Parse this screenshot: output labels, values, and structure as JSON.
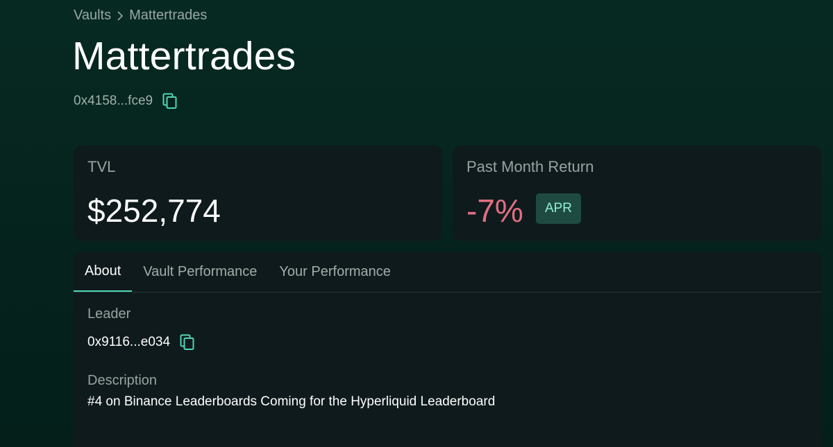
{
  "breadcrumb": {
    "parent": "Vaults",
    "current": "Mattertrades"
  },
  "vault": {
    "name": "Mattertrades",
    "address": "0x4158...fce9"
  },
  "stats": {
    "tvl_label": "TVL",
    "tvl_value": "$252,774",
    "return_label": "Past Month Return",
    "return_value": "-7%",
    "apr_label": "APR"
  },
  "tabs": [
    {
      "label": "About",
      "active": true
    },
    {
      "label": "Vault Performance",
      "active": false
    },
    {
      "label": "Your Performance",
      "active": false
    }
  ],
  "about": {
    "leader_label": "Leader",
    "leader_address": "0x9116...e034",
    "description_label": "Description",
    "description": "#4 on Binance Leaderboards Coming for the Hyperliquid Leaderboard"
  },
  "colors": {
    "background": "#05221c",
    "card": "#0f1a1c",
    "accent": "#4fd6b4",
    "negative": "#e06f81",
    "badge_bg": "#1f4a42"
  },
  "icons": {
    "copy": "copy-icon",
    "chevron": "chevron-right-icon"
  }
}
